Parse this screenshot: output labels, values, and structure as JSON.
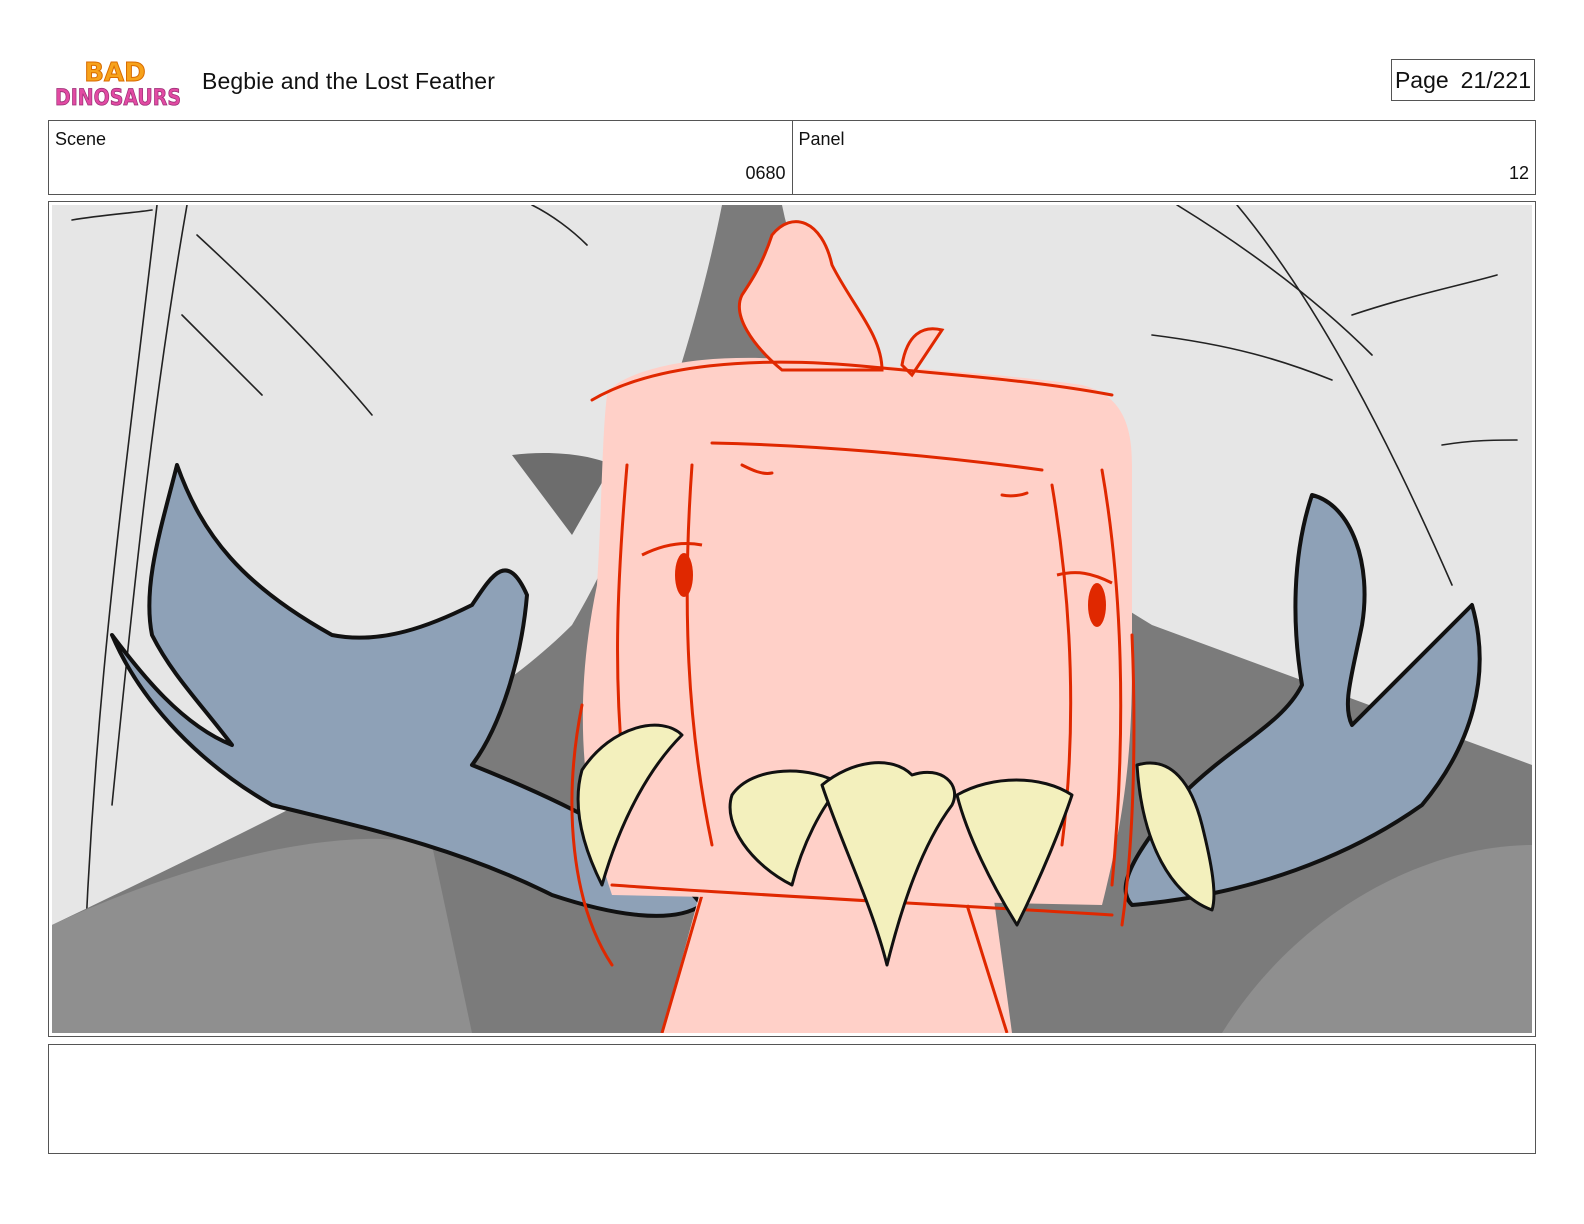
{
  "header": {
    "logo_text": "BAD DINOSAURS",
    "logo_line1": "BAD",
    "logo_line2": "DINOSAURS",
    "title": "Begbie and the Lost Feather",
    "page_label": "Page",
    "page_number": "21/221"
  },
  "info": {
    "scene_label": "Scene",
    "scene_value": "0680",
    "panel_label": "Panel",
    "panel_value": "12"
  },
  "panel": {
    "description_colors": {
      "background": "#e6e6e6",
      "dark_shape": "#7b7b7b",
      "body_pink": "#ffd0c8",
      "outline_red": "#e02800",
      "arm_blue": "#8ea1b7",
      "teeth_cream": "#f3f0bd"
    }
  },
  "notes": {
    "text": ""
  }
}
